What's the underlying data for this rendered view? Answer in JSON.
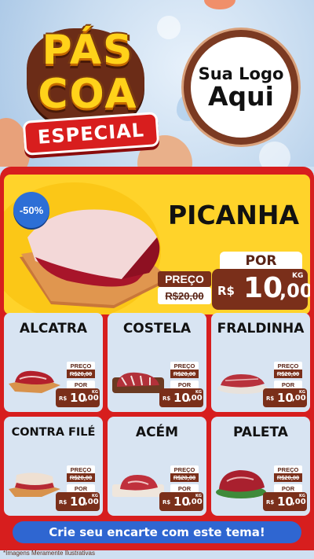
{
  "header": {
    "title_line1": "PÁS",
    "title_line2": "COA",
    "title_ribbon": "ESPECIAL",
    "logo_line1": "Sua Logo",
    "logo_line2": "Aqui"
  },
  "featured": {
    "discount": "-50%",
    "name": "PICANHA",
    "preco_label": "PREÇO",
    "old_price": "R$20,00",
    "por_label": "POR",
    "currency": "R$",
    "price_int": "10",
    "price_cents": ",00",
    "unit": "KG"
  },
  "price_labels": {
    "preco": "PREÇO",
    "old": "R$20,00",
    "por": "POR",
    "currency": "R$",
    "int": "10",
    "cents": ",00",
    "unit": "KG"
  },
  "products": [
    {
      "name": "ALCATRA"
    },
    {
      "name": "COSTELA"
    },
    {
      "name": "FRALDINHA"
    },
    {
      "name": "CONTRA FILÉ"
    },
    {
      "name": "ACÉM"
    },
    {
      "name": "PALETA"
    }
  ],
  "cta": "Crie seu encarte com este tema!",
  "footnote": "*Imagens Meramente Ilustrativas",
  "colors": {
    "panel_red": "#d71e1e",
    "feature_yellow": "#ffd32a",
    "price_brown": "#7a2f1a",
    "cta_blue": "#2f66d1",
    "discount_blue": "#2d6fd6"
  }
}
